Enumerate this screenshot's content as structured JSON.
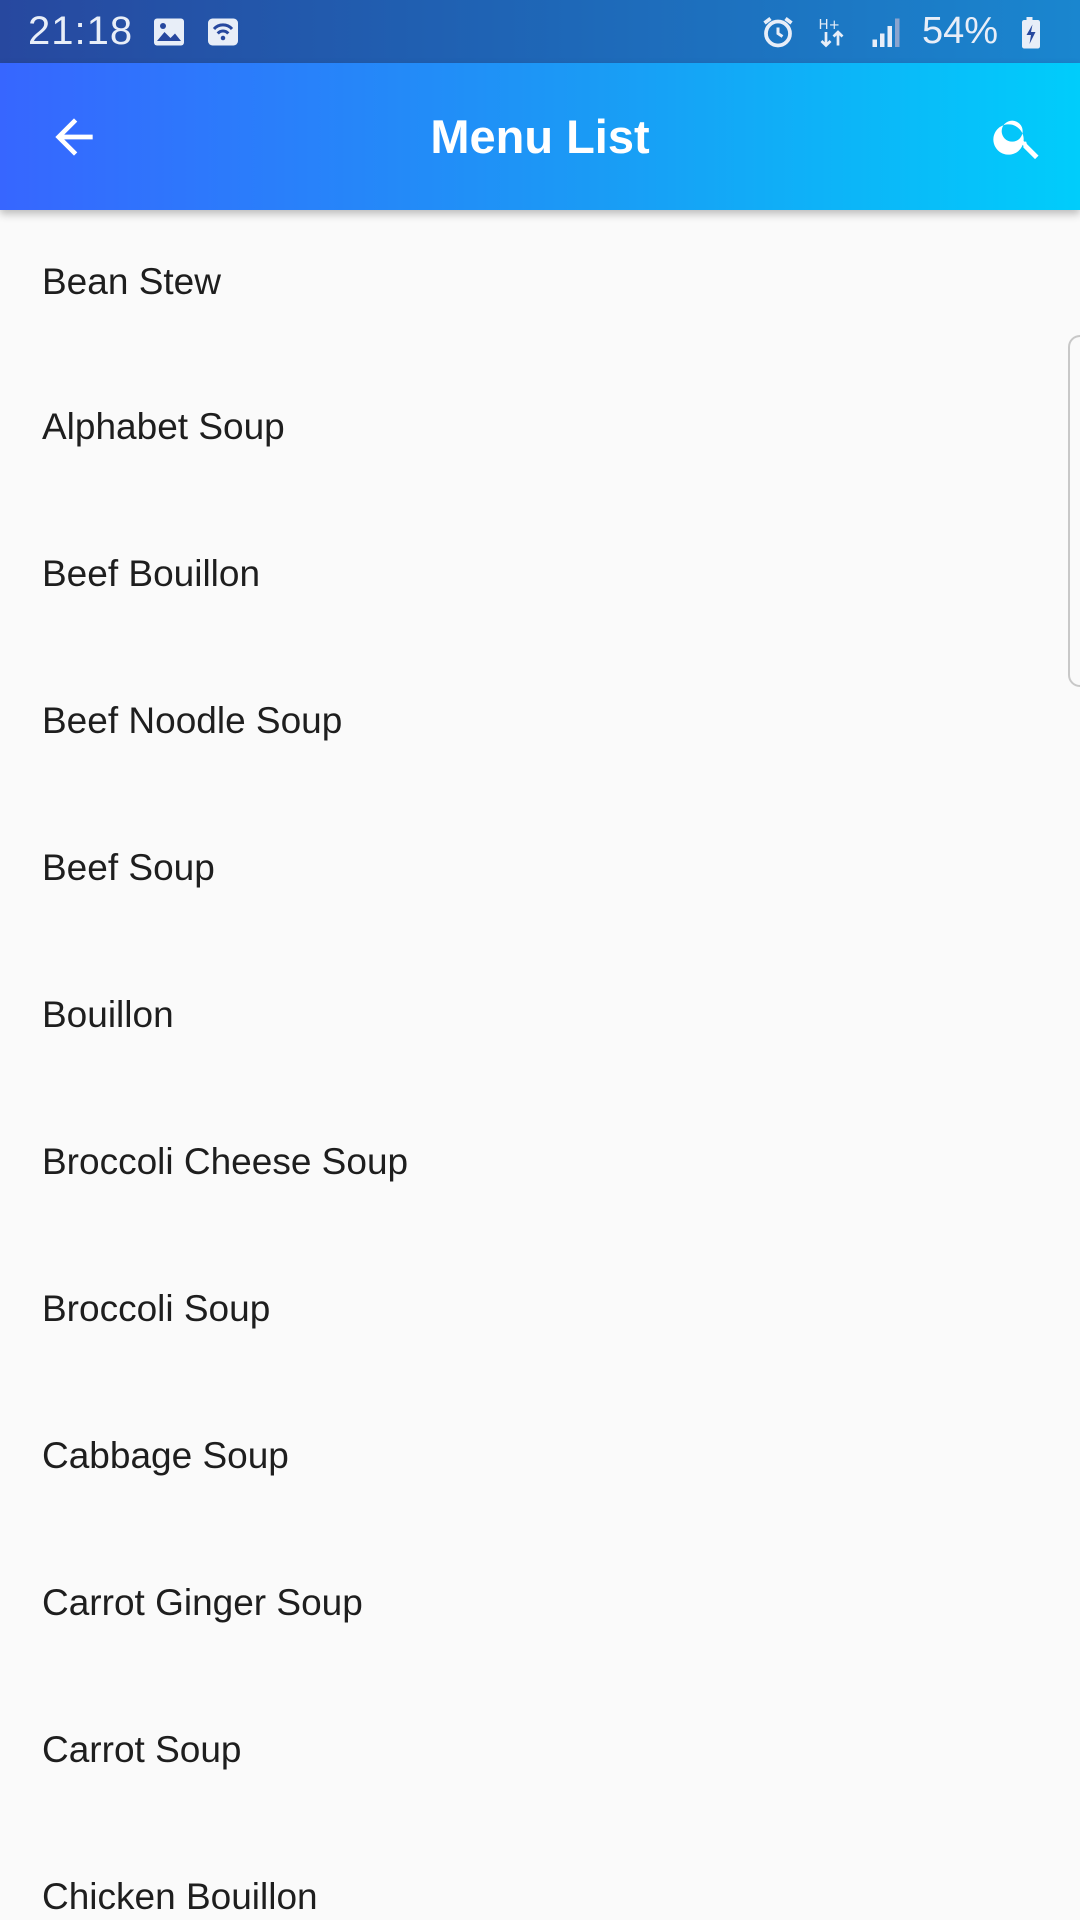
{
  "status_bar": {
    "time": "21:18",
    "battery_percent": "54%",
    "icons_left": [
      "gallery-icon",
      "wifi-icon"
    ],
    "icons_right": [
      "alarm-icon",
      "data-transfer-icon",
      "signal-icon",
      "battery-charging-icon"
    ]
  },
  "app_bar": {
    "title": "Menu List",
    "back_icon": "arrow-back-icon",
    "search_icon": "search-icon",
    "gradient": [
      "#3766ff",
      "#00cdfb"
    ]
  },
  "menu": {
    "items": [
      "Bean Stew",
      "Alphabet Soup",
      "Beef Bouillon",
      "Beef Noodle Soup",
      "Beef Soup",
      "Bouillon",
      "Broccoli Cheese Soup",
      "Broccoli Soup",
      "Cabbage Soup",
      "Carrot Ginger Soup",
      "Carrot Soup",
      "Chicken Bouillon"
    ]
  }
}
